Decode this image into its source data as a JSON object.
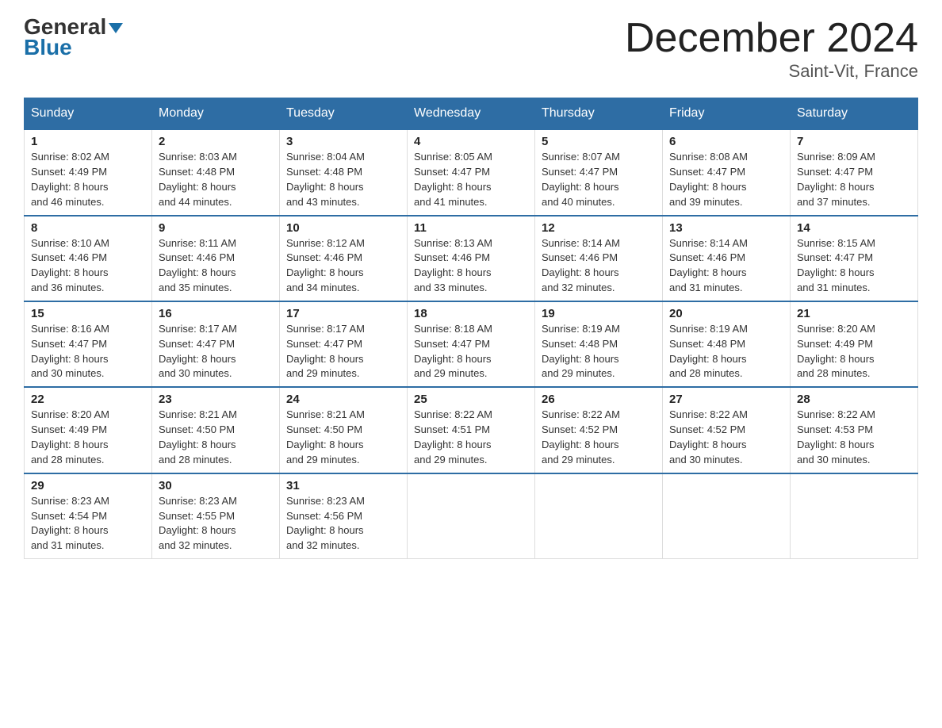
{
  "logo": {
    "general": "General",
    "blue": "Blue"
  },
  "title": "December 2024",
  "subtitle": "Saint-Vit, France",
  "days_header": [
    "Sunday",
    "Monday",
    "Tuesday",
    "Wednesday",
    "Thursday",
    "Friday",
    "Saturday"
  ],
  "weeks": [
    [
      {
        "day": "1",
        "sunrise": "8:02 AM",
        "sunset": "4:49 PM",
        "daylight": "8 hours and 46 minutes."
      },
      {
        "day": "2",
        "sunrise": "8:03 AM",
        "sunset": "4:48 PM",
        "daylight": "8 hours and 44 minutes."
      },
      {
        "day": "3",
        "sunrise": "8:04 AM",
        "sunset": "4:48 PM",
        "daylight": "8 hours and 43 minutes."
      },
      {
        "day": "4",
        "sunrise": "8:05 AM",
        "sunset": "4:47 PM",
        "daylight": "8 hours and 41 minutes."
      },
      {
        "day": "5",
        "sunrise": "8:07 AM",
        "sunset": "4:47 PM",
        "daylight": "8 hours and 40 minutes."
      },
      {
        "day": "6",
        "sunrise": "8:08 AM",
        "sunset": "4:47 PM",
        "daylight": "8 hours and 39 minutes."
      },
      {
        "day": "7",
        "sunrise": "8:09 AM",
        "sunset": "4:47 PM",
        "daylight": "8 hours and 37 minutes."
      }
    ],
    [
      {
        "day": "8",
        "sunrise": "8:10 AM",
        "sunset": "4:46 PM",
        "daylight": "8 hours and 36 minutes."
      },
      {
        "day": "9",
        "sunrise": "8:11 AM",
        "sunset": "4:46 PM",
        "daylight": "8 hours and 35 minutes."
      },
      {
        "day": "10",
        "sunrise": "8:12 AM",
        "sunset": "4:46 PM",
        "daylight": "8 hours and 34 minutes."
      },
      {
        "day": "11",
        "sunrise": "8:13 AM",
        "sunset": "4:46 PM",
        "daylight": "8 hours and 33 minutes."
      },
      {
        "day": "12",
        "sunrise": "8:14 AM",
        "sunset": "4:46 PM",
        "daylight": "8 hours and 32 minutes."
      },
      {
        "day": "13",
        "sunrise": "8:14 AM",
        "sunset": "4:46 PM",
        "daylight": "8 hours and 31 minutes."
      },
      {
        "day": "14",
        "sunrise": "8:15 AM",
        "sunset": "4:47 PM",
        "daylight": "8 hours and 31 minutes."
      }
    ],
    [
      {
        "day": "15",
        "sunrise": "8:16 AM",
        "sunset": "4:47 PM",
        "daylight": "8 hours and 30 minutes."
      },
      {
        "day": "16",
        "sunrise": "8:17 AM",
        "sunset": "4:47 PM",
        "daylight": "8 hours and 30 minutes."
      },
      {
        "day": "17",
        "sunrise": "8:17 AM",
        "sunset": "4:47 PM",
        "daylight": "8 hours and 29 minutes."
      },
      {
        "day": "18",
        "sunrise": "8:18 AM",
        "sunset": "4:47 PM",
        "daylight": "8 hours and 29 minutes."
      },
      {
        "day": "19",
        "sunrise": "8:19 AM",
        "sunset": "4:48 PM",
        "daylight": "8 hours and 29 minutes."
      },
      {
        "day": "20",
        "sunrise": "8:19 AM",
        "sunset": "4:48 PM",
        "daylight": "8 hours and 28 minutes."
      },
      {
        "day": "21",
        "sunrise": "8:20 AM",
        "sunset": "4:49 PM",
        "daylight": "8 hours and 28 minutes."
      }
    ],
    [
      {
        "day": "22",
        "sunrise": "8:20 AM",
        "sunset": "4:49 PM",
        "daylight": "8 hours and 28 minutes."
      },
      {
        "day": "23",
        "sunrise": "8:21 AM",
        "sunset": "4:50 PM",
        "daylight": "8 hours and 28 minutes."
      },
      {
        "day": "24",
        "sunrise": "8:21 AM",
        "sunset": "4:50 PM",
        "daylight": "8 hours and 29 minutes."
      },
      {
        "day": "25",
        "sunrise": "8:22 AM",
        "sunset": "4:51 PM",
        "daylight": "8 hours and 29 minutes."
      },
      {
        "day": "26",
        "sunrise": "8:22 AM",
        "sunset": "4:52 PM",
        "daylight": "8 hours and 29 minutes."
      },
      {
        "day": "27",
        "sunrise": "8:22 AM",
        "sunset": "4:52 PM",
        "daylight": "8 hours and 30 minutes."
      },
      {
        "day": "28",
        "sunrise": "8:22 AM",
        "sunset": "4:53 PM",
        "daylight": "8 hours and 30 minutes."
      }
    ],
    [
      {
        "day": "29",
        "sunrise": "8:23 AM",
        "sunset": "4:54 PM",
        "daylight": "8 hours and 31 minutes."
      },
      {
        "day": "30",
        "sunrise": "8:23 AM",
        "sunset": "4:55 PM",
        "daylight": "8 hours and 32 minutes."
      },
      {
        "day": "31",
        "sunrise": "8:23 AM",
        "sunset": "4:56 PM",
        "daylight": "8 hours and 32 minutes."
      },
      null,
      null,
      null,
      null
    ]
  ],
  "labels": {
    "sunrise": "Sunrise:",
    "sunset": "Sunset:",
    "daylight": "Daylight:"
  },
  "colors": {
    "header_bg": "#2e6da4",
    "header_text": "#ffffff",
    "border": "#2e6da4"
  }
}
